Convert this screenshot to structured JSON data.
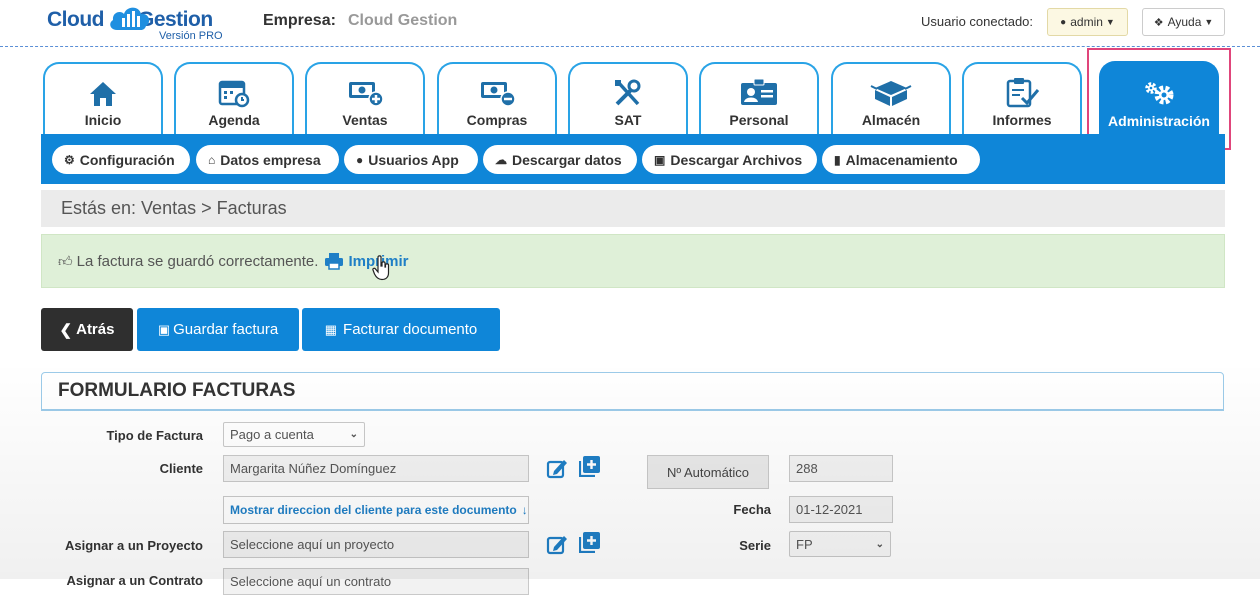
{
  "header": {
    "logo_word1": "Cloud",
    "logo_word2": "Gestion",
    "logo_version": "Versión PRO",
    "empresa_label": "Empresa:",
    "empresa_value": "Cloud Gestion",
    "user_label": "Usuario conectado:",
    "user_button": "admin",
    "help_button": "Ayuda"
  },
  "tabs": [
    {
      "label": "Inicio",
      "icon": "home-icon"
    },
    {
      "label": "Agenda",
      "icon": "calendar-icon"
    },
    {
      "label": "Ventas",
      "icon": "money-plus-icon"
    },
    {
      "label": "Compras",
      "icon": "money-minus-icon"
    },
    {
      "label": "SAT",
      "icon": "tools-icon"
    },
    {
      "label": "Personal",
      "icon": "id-card-icon"
    },
    {
      "label": "Almacén",
      "icon": "boxes-icon"
    },
    {
      "label": "Informes",
      "icon": "clipboard-check-icon"
    },
    {
      "label": "Administración",
      "icon": "gears-icon",
      "active": true
    }
  ],
  "subnav": [
    {
      "label": "Configuración",
      "icon": "gear-icon"
    },
    {
      "label": "Datos empresa",
      "icon": "home-icon"
    },
    {
      "label": "Usuarios App",
      "icon": "user-icon"
    },
    {
      "label": "Descargar datos",
      "icon": "cloud-download-icon"
    },
    {
      "label": "Descargar Archivos",
      "icon": "briefcase-icon"
    },
    {
      "label": "Almacenamiento",
      "icon": "book-icon"
    }
  ],
  "breadcrumb": "Estás en: Ventas > Facturas",
  "alert": {
    "message": "La factura se guardó correctamente.",
    "print_link": "Imprimir"
  },
  "actions": {
    "back": "Atrás",
    "save": "Guardar factura",
    "bill": "Facturar documento"
  },
  "form": {
    "title": "FORMULARIO FACTURAS",
    "tipo_label": "Tipo de Factura",
    "tipo_value": "Pago a cuenta",
    "cliente_label": "Cliente",
    "cliente_value": "Margarita Núñez Domínguez",
    "auto_button": "Nº Automático",
    "numero_value": "288",
    "mostrar_link": "Mostrar direccion del cliente para este documento",
    "fecha_label": "Fecha",
    "fecha_value": "01-12-2021",
    "proyecto_label": "Asignar a un Proyecto",
    "proyecto_placeholder": "Seleccione aquí un proyecto",
    "serie_label": "Serie",
    "serie_value": "FP",
    "contrato_label": "Asignar a un Contrato",
    "contrato_placeholder": "Seleccione aquí un contrato"
  },
  "colors": {
    "brand_blue": "#0f86d8",
    "tab_border": "#29a3e6",
    "success_bg": "#dff0d8",
    "highlight": "#e0457b"
  }
}
